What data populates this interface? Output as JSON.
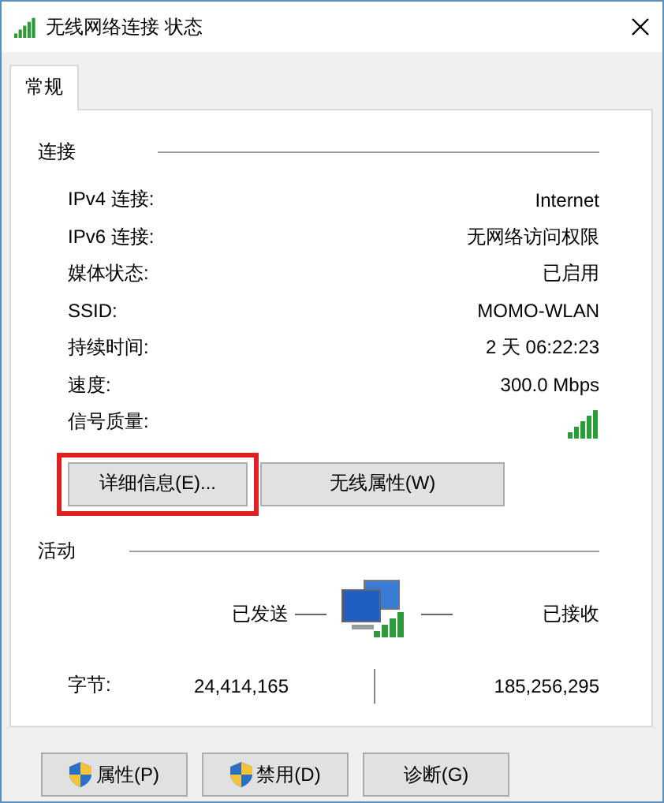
{
  "window": {
    "title": "无线网络连接 状态"
  },
  "tabs": [
    {
      "label": "常规",
      "selected": true
    }
  ],
  "connection": {
    "heading": "连接",
    "rows": [
      {
        "kind": "text",
        "label": "IPv4 连接:",
        "value": "Internet"
      },
      {
        "kind": "text",
        "label": "IPv6 连接:",
        "value": "无网络访问权限"
      },
      {
        "kind": "text",
        "label": "媒体状态:",
        "value": "已启用"
      },
      {
        "kind": "text",
        "label": "SSID:",
        "value": "MOMO-WLAN"
      },
      {
        "kind": "text",
        "label": "持续时间:",
        "value": "2 天 06:22:23"
      },
      {
        "kind": "text",
        "label": "速度:",
        "value": "300.0 Mbps"
      },
      {
        "kind": "signal",
        "label": "信号质量:"
      }
    ],
    "buttons": [
      {
        "label": "详细信息(E)...",
        "highlighted": true
      },
      {
        "label": "无线属性(W)",
        "highlighted": false
      }
    ]
  },
  "activity": {
    "heading": "活动",
    "sent_label": "已发送",
    "received_label": "已接收",
    "bytes_label": "字节:",
    "sent": "24,414,165",
    "received": "185,256,295"
  },
  "footer_buttons": [
    {
      "label": "属性(P)",
      "shield": true
    },
    {
      "label": "禁用(D)",
      "shield": true
    },
    {
      "label": "诊断(G)",
      "shield": false
    }
  ]
}
